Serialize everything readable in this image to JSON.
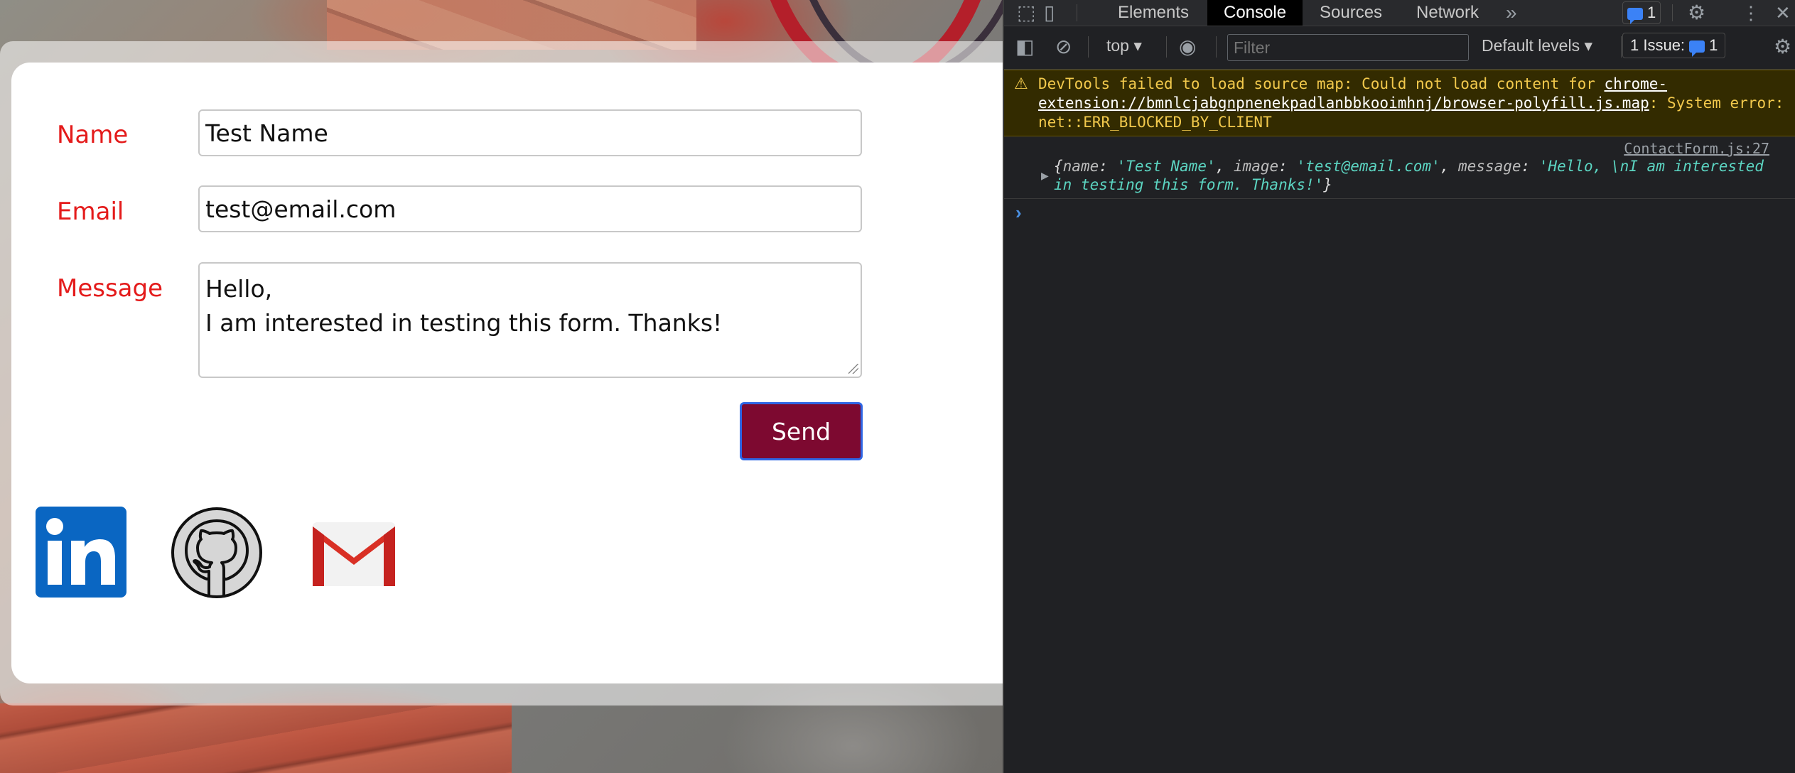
{
  "form": {
    "name_label": "Name",
    "name_value": "Test Name",
    "email_label": "Email",
    "email_value": "test@email.com",
    "message_label": "Message",
    "message_value": "Hello,\nI am interested in testing this form. Thanks!",
    "send_label": "Send"
  },
  "social": [
    "linkedin-icon",
    "github-icon",
    "gmail-icon"
  ],
  "devtools": {
    "tabs": [
      "Elements",
      "Console",
      "Sources",
      "Network"
    ],
    "active_tab": "Console",
    "issues_badge_count": "1",
    "context": "top",
    "filter_placeholder": "Filter",
    "levels": "Default levels",
    "issues_label": "1 Issue:",
    "issues_count": "1",
    "warning": {
      "prefix": "DevTools failed to load source map: Could not load content for ",
      "link": "chrome-extension://bmnlcjabgnpnenekpadlanbbkooimhnj/browser-polyfill.js.map",
      "suffix": ": System error: net::ERR_BLOCKED_BY_CLIENT"
    },
    "log": {
      "source": "ContactForm.js:27",
      "open": "{",
      "k1": "name",
      "v1": "'Test Name'",
      "k2": "image",
      "v2": "'test@email.com'",
      "k3": "message",
      "v3": "'Hello, \\nI am interested in testing this form. Thanks!'",
      "close": "}"
    }
  },
  "colors": {
    "label_red": "#e41b1b",
    "send_bg": "#7d0930",
    "send_border": "#2e66e5",
    "warning_text": "#f2c94c",
    "string_value": "#5cd5c2"
  }
}
